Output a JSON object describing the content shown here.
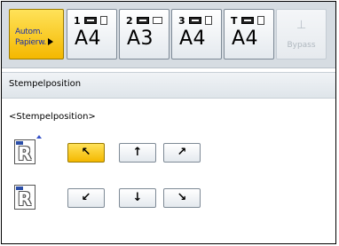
{
  "auto_paper": {
    "line1": "Autom.",
    "line2": "Papierw."
  },
  "trays": [
    {
      "num": "1",
      "size": "A4"
    },
    {
      "num": "2",
      "size": "A3"
    },
    {
      "num": "3",
      "size": "A4"
    },
    {
      "num": "T",
      "size": "A4"
    }
  ],
  "bypass": {
    "icon": "bypass-tray-icon",
    "label": "Bypass"
  },
  "header": {
    "title": "Stempelposition"
  },
  "section": {
    "label": "<Stempelposition>"
  },
  "positions": {
    "top_left": "↖",
    "top_center": "↑",
    "top_right": "↗",
    "bottom_left": "↙",
    "bottom_center": "↓",
    "bottom_right": "↘",
    "selected": "top_left"
  }
}
